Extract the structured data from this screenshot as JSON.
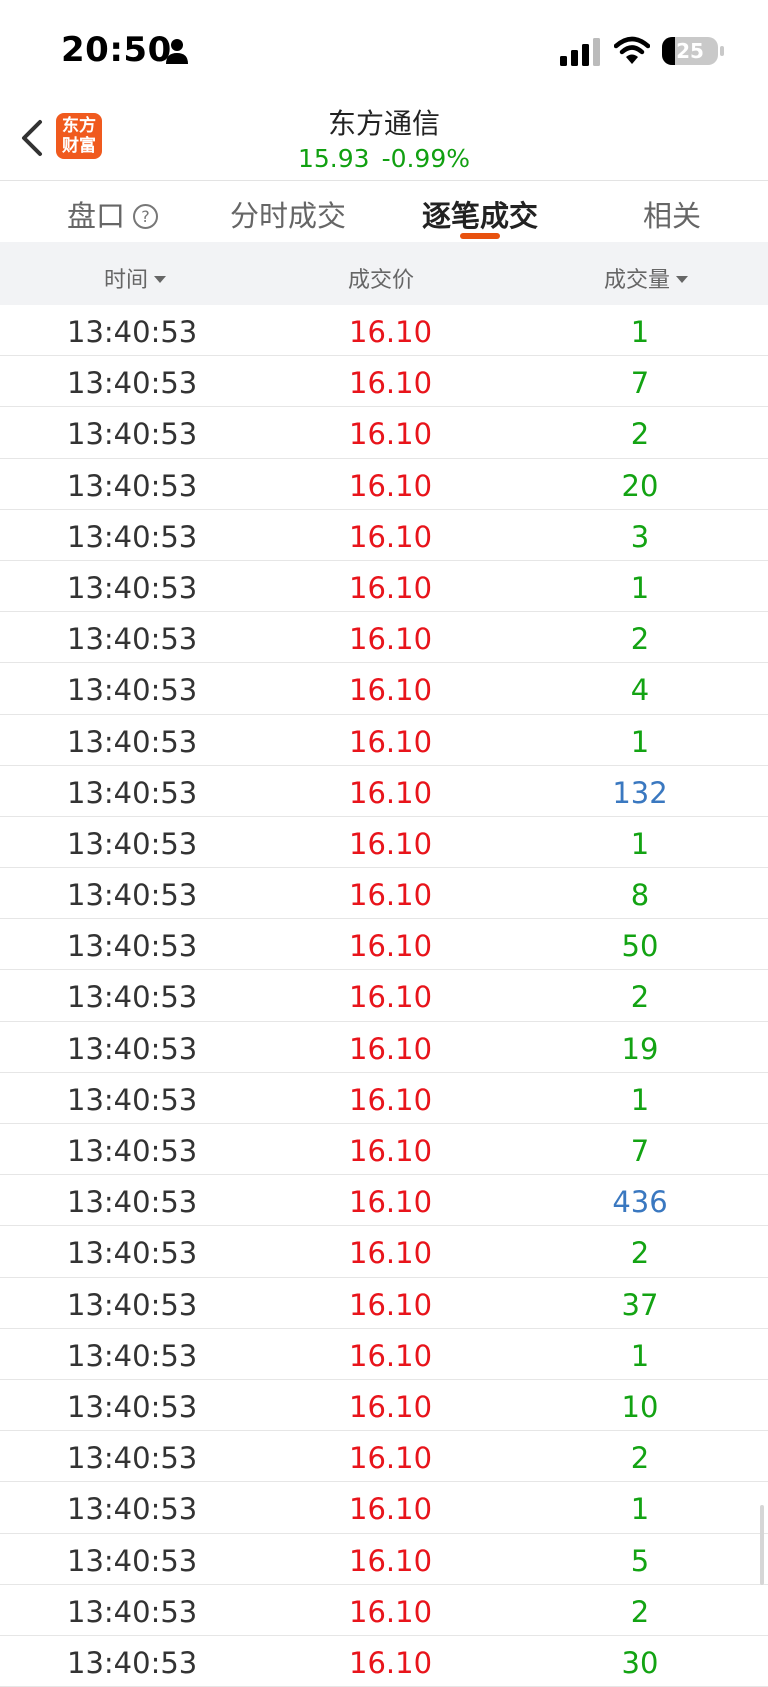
{
  "status_bar": {
    "time": "20:50",
    "battery": "25"
  },
  "header": {
    "name": "东方通信",
    "price": "15.93",
    "change": "-0.99%",
    "logo_line1": "东方",
    "logo_line2": "财富"
  },
  "tabs": [
    {
      "label": "盘口",
      "help": "?"
    },
    {
      "label": "分时成交"
    },
    {
      "label": "逐笔成交",
      "active": true
    },
    {
      "label": "相关"
    }
  ],
  "columns": {
    "time": "时间",
    "price": "成交价",
    "volume": "成交量"
  },
  "colors": {
    "up": "#e8141b",
    "down": "#13a313",
    "big": "#3a78c0",
    "accent": "#e8520f"
  },
  "rows": [
    {
      "time": "13:40:53",
      "price": "16.10",
      "volume": "1",
      "type": "green"
    },
    {
      "time": "13:40:53",
      "price": "16.10",
      "volume": "7",
      "type": "green"
    },
    {
      "time": "13:40:53",
      "price": "16.10",
      "volume": "2",
      "type": "green"
    },
    {
      "time": "13:40:53",
      "price": "16.10",
      "volume": "20",
      "type": "green"
    },
    {
      "time": "13:40:53",
      "price": "16.10",
      "volume": "3",
      "type": "green"
    },
    {
      "time": "13:40:53",
      "price": "16.10",
      "volume": "1",
      "type": "green"
    },
    {
      "time": "13:40:53",
      "price": "16.10",
      "volume": "2",
      "type": "green"
    },
    {
      "time": "13:40:53",
      "price": "16.10",
      "volume": "4",
      "type": "green"
    },
    {
      "time": "13:40:53",
      "price": "16.10",
      "volume": "1",
      "type": "green"
    },
    {
      "time": "13:40:53",
      "price": "16.10",
      "volume": "132",
      "type": "blue"
    },
    {
      "time": "13:40:53",
      "price": "16.10",
      "volume": "1",
      "type": "green"
    },
    {
      "time": "13:40:53",
      "price": "16.10",
      "volume": "8",
      "type": "green"
    },
    {
      "time": "13:40:53",
      "price": "16.10",
      "volume": "50",
      "type": "green"
    },
    {
      "time": "13:40:53",
      "price": "16.10",
      "volume": "2",
      "type": "green"
    },
    {
      "time": "13:40:53",
      "price": "16.10",
      "volume": "19",
      "type": "green"
    },
    {
      "time": "13:40:53",
      "price": "16.10",
      "volume": "1",
      "type": "green"
    },
    {
      "time": "13:40:53",
      "price": "16.10",
      "volume": "7",
      "type": "green"
    },
    {
      "time": "13:40:53",
      "price": "16.10",
      "volume": "436",
      "type": "blue"
    },
    {
      "time": "13:40:53",
      "price": "16.10",
      "volume": "2",
      "type": "green"
    },
    {
      "time": "13:40:53",
      "price": "16.10",
      "volume": "37",
      "type": "green"
    },
    {
      "time": "13:40:53",
      "price": "16.10",
      "volume": "1",
      "type": "green"
    },
    {
      "time": "13:40:53",
      "price": "16.10",
      "volume": "10",
      "type": "green"
    },
    {
      "time": "13:40:53",
      "price": "16.10",
      "volume": "2",
      "type": "green"
    },
    {
      "time": "13:40:53",
      "price": "16.10",
      "volume": "1",
      "type": "green"
    },
    {
      "time": "13:40:53",
      "price": "16.10",
      "volume": "5",
      "type": "green"
    },
    {
      "time": "13:40:53",
      "price": "16.10",
      "volume": "2",
      "type": "green"
    },
    {
      "time": "13:40:53",
      "price": "16.10",
      "volume": "30",
      "type": "green"
    }
  ]
}
